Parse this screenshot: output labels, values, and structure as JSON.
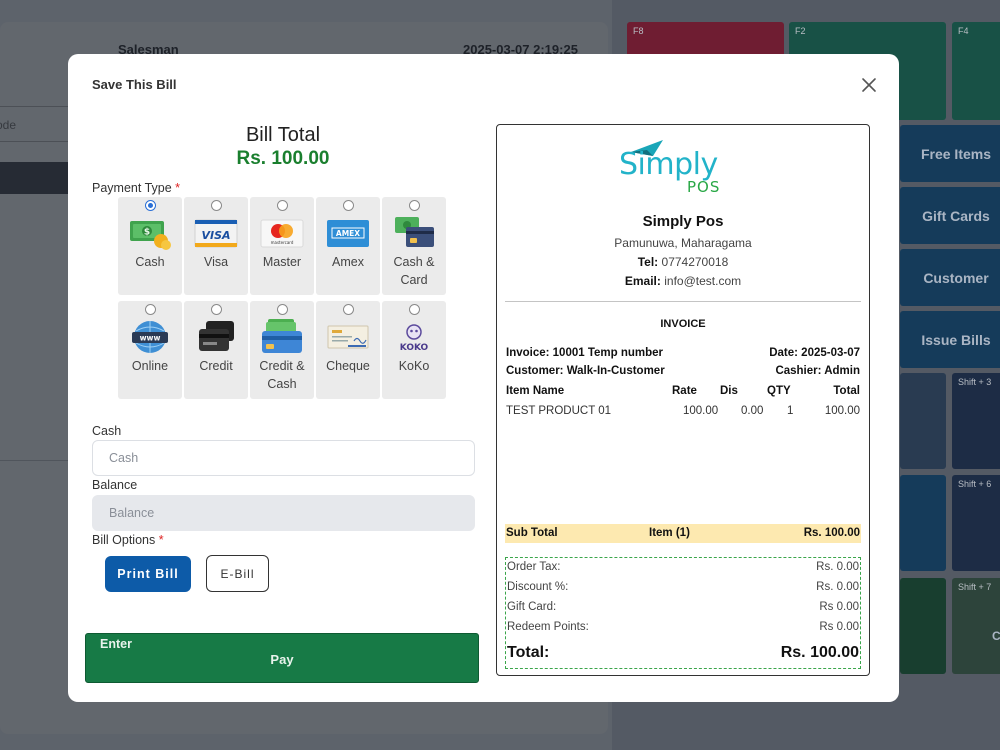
{
  "background": {
    "salesman_label": "Salesman",
    "datetime": "2025-03-07 2:19:25",
    "barcode_placeholder": "ode",
    "tiles": {
      "f8": "F8",
      "f2": "F2",
      "f4": "F4",
      "free_items": "Free Items",
      "gift_cards": "Gift Cards",
      "customer": "Customer",
      "issue_bills": "Issue Bills",
      "shift3": "Shift + 3",
      "shift6": "Shift + 6",
      "shift7": "Shift + 7",
      "partial": "Cl"
    }
  },
  "modal": {
    "title": "Save This Bill",
    "bill_total_label": "Bill Total",
    "bill_total_amount": "Rs. 100.00",
    "payment_type_label": "Payment Type",
    "required_mark": "*",
    "payment_types": [
      {
        "label": "Cash",
        "icon": "cash-icon",
        "selected": true
      },
      {
        "label": "Visa",
        "icon": "visa-icon",
        "selected": false
      },
      {
        "label": "Master",
        "icon": "mastercard-icon",
        "selected": false
      },
      {
        "label": "Amex",
        "icon": "amex-icon",
        "selected": false
      },
      {
        "label": "Cash & Card",
        "icon": "cash-card-icon",
        "selected": false
      },
      {
        "label": "Online",
        "icon": "globe-icon",
        "selected": false
      },
      {
        "label": "Credit",
        "icon": "credit-icon",
        "selected": false
      },
      {
        "label": "Credit & Cash",
        "icon": "credit-cash-icon",
        "selected": false
      },
      {
        "label": "Cheque",
        "icon": "cheque-icon",
        "selected": false
      },
      {
        "label": "KoKo",
        "icon": "koko-icon",
        "selected": false
      }
    ],
    "cash_label": "Cash",
    "cash_placeholder": "Cash",
    "balance_label": "Balance",
    "balance_placeholder": "Balance",
    "bill_options_label": "Bill Options",
    "print_bill_label": "Print Bill",
    "ebill_label": "E-Bill",
    "pay_shortcut": "Enter",
    "pay_label": "Pay"
  },
  "receipt": {
    "logo_text_main": "Simply",
    "logo_text_sub": "POS",
    "store_name": "Simply Pos",
    "address": "Pamunuwa, Maharagama",
    "tel_label": "Tel:",
    "tel": "0774270018",
    "email_label": "Email:",
    "email": "info@test.com",
    "doc_title": "INVOICE",
    "invoice": "Invoice: 10001 Temp number",
    "date": "Date: 2025-03-07",
    "customer": "Customer: Walk-In-Customer",
    "cashier": "Cashier: Admin",
    "columns": [
      "Item Name",
      "Rate",
      "Dis",
      "QTY",
      "Total"
    ],
    "items": [
      {
        "name": "TEST PRODUCT 01",
        "rate": "100.00",
        "dis": "0.00",
        "qty": "1",
        "total": "100.00"
      }
    ],
    "subtotal_label": "Sub Total",
    "item_count": "Item (1)",
    "subtotal_value": "Rs. 100.00",
    "order_tax_label": "Order Tax:",
    "order_tax_value": "Rs. 0.00",
    "discount_label": "Discount %:",
    "discount_value": "Rs. 0.00",
    "gift_card_label": "Gift Card:",
    "gift_card_value": "Rs 0.00",
    "redeem_label": "Redeem Points:",
    "redeem_value": "Rs 0.00",
    "total_label": "Total:",
    "total_value": "Rs. 100.00"
  },
  "colors": {
    "pay_button": "#177a46",
    "print_button": "#0d5ba8",
    "total_amount": "#1a7f2e",
    "subtotal_bg": "#fde9b0"
  }
}
